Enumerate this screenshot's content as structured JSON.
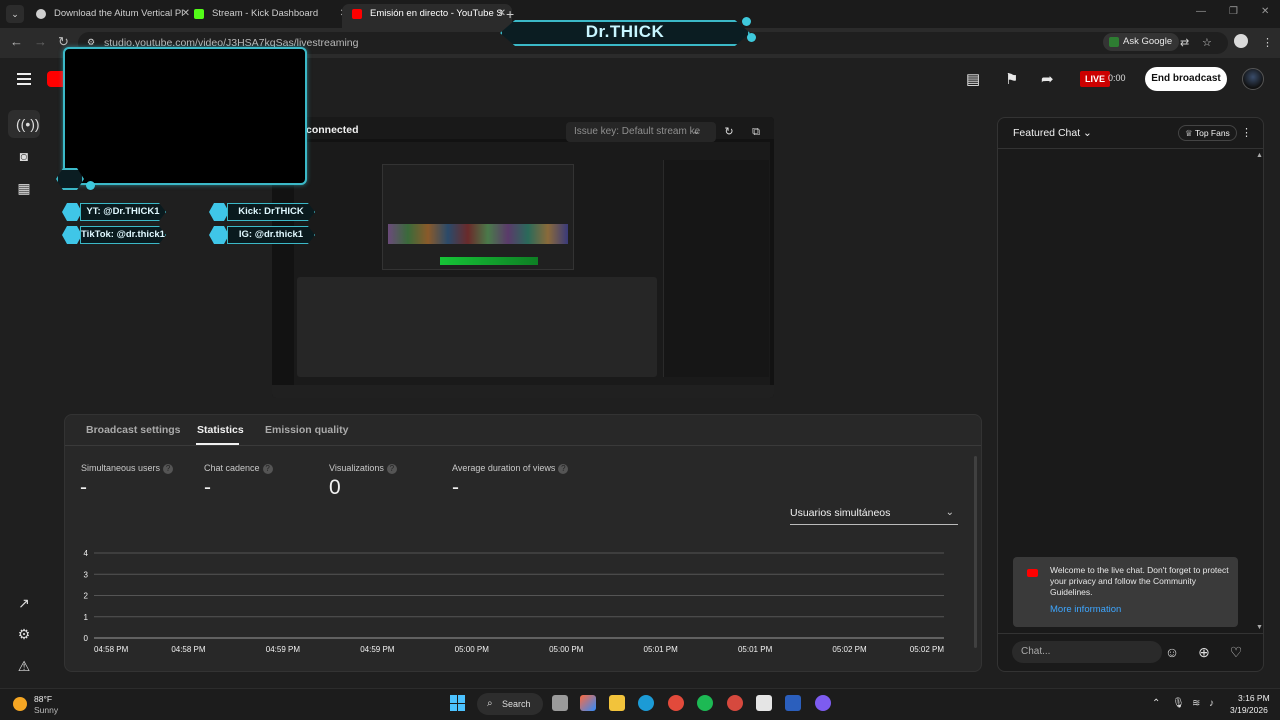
{
  "browser": {
    "tabs": [
      {
        "title": "Download the Aitum Vertical Pl",
        "color": "#cfcfcf"
      },
      {
        "title": "Stream - Kick Dashboard",
        "color": "#53fc18"
      },
      {
        "title": "Emisión en directo - YouTube S",
        "color": "#ff0000"
      }
    ],
    "url": "studio.youtube.com/video/J3HSA7kqSas/livestreaming",
    "ask_google": "Ask Google"
  },
  "overlay": {
    "title": "Dr.THICK",
    "socials": {
      "yt": "YT: @Dr.THICK1",
      "kick": "Kick: DrTHICK",
      "tiktok": "TikTok: @dr.thick1",
      "ig": "IG: @dr.thick1"
    }
  },
  "header": {
    "live_label": "LIVE",
    "live_time": "0:00",
    "end_broadcast": "End broadcast"
  },
  "preview": {
    "status": "connected",
    "issue_placeholder": "Issue key: Default stream ke"
  },
  "stats": {
    "tabs": [
      "Broadcast settings",
      "Statistics",
      "Emission quality"
    ],
    "active_tab": "Statistics",
    "metrics": [
      {
        "label": "Simultaneous users",
        "value": "-"
      },
      {
        "label": "Chat cadence",
        "value": "-"
      },
      {
        "label": "Visualizations",
        "value": "0"
      },
      {
        "label": "Average duration of views",
        "value": "-"
      }
    ],
    "metric_select": "Usuarios simultáneos"
  },
  "chart_data": {
    "type": "line",
    "title": "",
    "xlabel": "",
    "ylabel": "",
    "x": [
      "04:58 PM",
      "04:58 PM",
      "04:59 PM",
      "04:59 PM",
      "05:00 PM",
      "05:00 PM",
      "05:01 PM",
      "05:01 PM",
      "05:02 PM",
      "05:02 PM"
    ],
    "y_ticks": [
      0,
      1,
      2,
      3,
      4
    ],
    "ylim": [
      0,
      4
    ],
    "grid": true,
    "series": []
  },
  "chat": {
    "title": "Featured Chat",
    "top_fans": "Top Fans",
    "welcome_text": "Welcome to the live chat. Don't forget to protect your privacy and follow the Community Guidelines.",
    "more_info": "More information",
    "input_placeholder": "Chat..."
  },
  "taskbar": {
    "temp": "88°F",
    "condition": "Sunny",
    "search": "Search",
    "time": "3:16 PM",
    "date": "3/19/2026"
  }
}
